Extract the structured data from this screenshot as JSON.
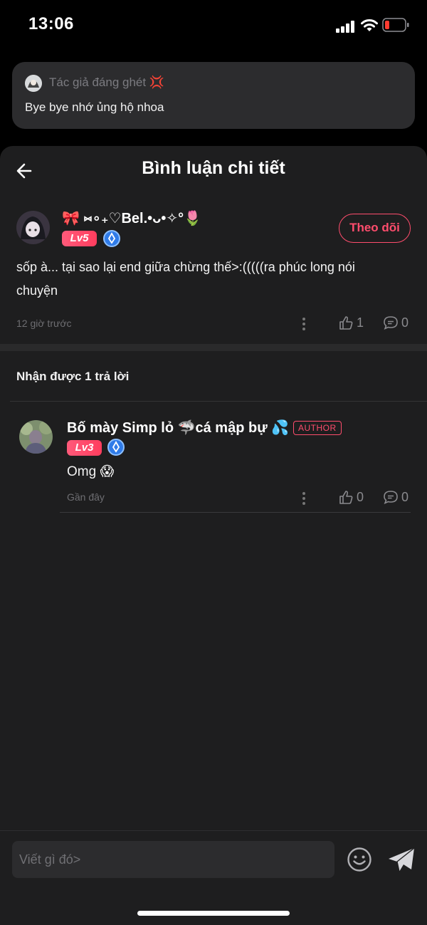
{
  "status_bar": {
    "time": "13:06"
  },
  "notification": {
    "sender": "Tác giả đáng ghét 💢",
    "message": "Bye bye nhớ ủng hộ nhoa"
  },
  "header": {
    "title": "Bình luận chi tiết"
  },
  "main_comment": {
    "username": "🎀 ⑅∘₊♡Bel.•ᴗ•✧°🌷",
    "level": "Lv5",
    "follow_label": "Theo dõi",
    "text": "sốp à... tại sao lại end giữa chừng thế>:(((((ra phúc long nói chuyện",
    "time": "12 giờ trước",
    "likes": "1",
    "replies": "0"
  },
  "replies_count_label": "Nhận được 1 trả lời",
  "reply": {
    "username": "Bố mày Simp lỏ 🦈cá mập bự 💦",
    "author_tag": "AUTHOR",
    "level": "Lv3",
    "text": "Omg 😱",
    "time": "Gần đây",
    "likes": "0",
    "replies": "0"
  },
  "input": {
    "placeholder": "Viết gì đó>"
  },
  "colors": {
    "accent": "#ff4d6d",
    "background": "#1e1e1f",
    "verify": "#2f7be8"
  }
}
